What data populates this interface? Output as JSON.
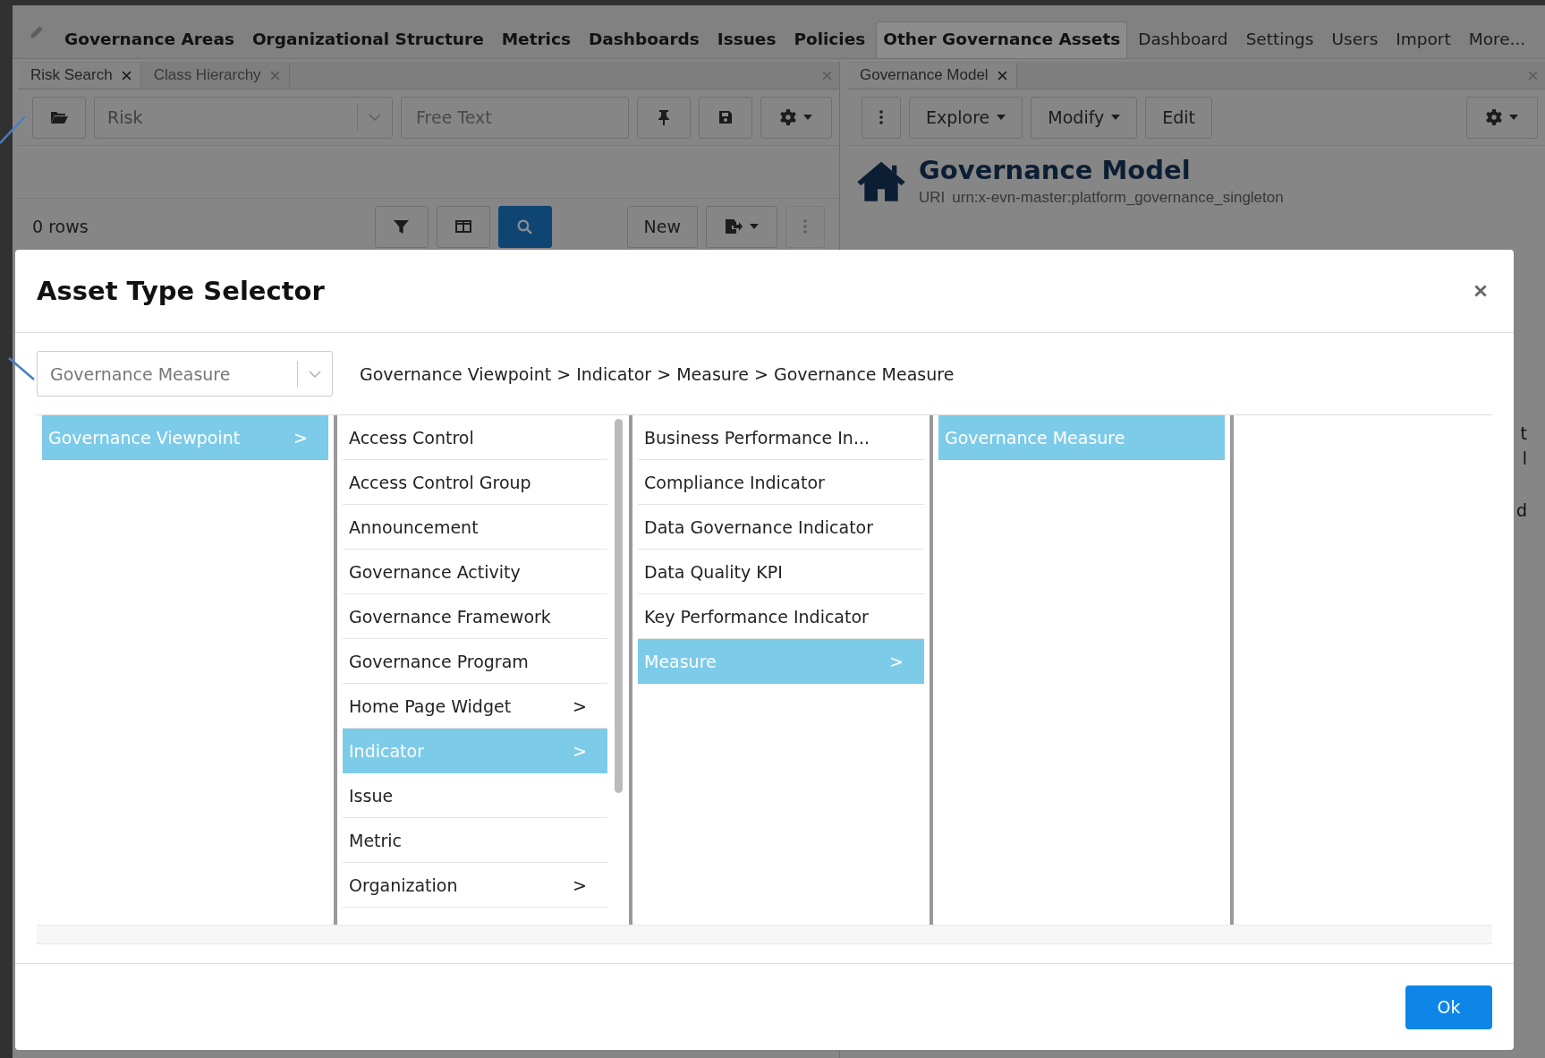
{
  "nav": {
    "items": [
      {
        "label": "Governance Areas",
        "bold": true,
        "selected": false
      },
      {
        "label": "Organizational Structure",
        "bold": true,
        "selected": false
      },
      {
        "label": "Metrics",
        "bold": true,
        "selected": false
      },
      {
        "label": "Dashboards",
        "bold": true,
        "selected": false
      },
      {
        "label": "Issues",
        "bold": true,
        "selected": false
      },
      {
        "label": "Policies",
        "bold": true,
        "selected": false
      },
      {
        "label": "Other Governance Assets",
        "bold": true,
        "selected": true
      },
      {
        "label": "Dashboard",
        "bold": false,
        "selected": false
      },
      {
        "label": "Settings",
        "bold": false,
        "selected": false
      },
      {
        "label": "Users",
        "bold": false,
        "selected": false
      },
      {
        "label": "Import",
        "bold": false,
        "selected": false
      },
      {
        "label": "More...",
        "bold": false,
        "selected": false
      }
    ]
  },
  "left_panel": {
    "tabs": [
      {
        "label": "Risk Search",
        "selected": true
      },
      {
        "label": "Class Hierarchy",
        "selected": false
      }
    ],
    "type_select": {
      "value": "Risk"
    },
    "search": {
      "placeholder": "Free Text"
    },
    "row_count": "0 rows",
    "new_button": "New"
  },
  "right_panel": {
    "tabs": [
      {
        "label": "Governance Model",
        "selected": true
      }
    ],
    "buttons": [
      "Explore",
      "Modify",
      "Edit"
    ],
    "title": "Governance Model",
    "uri_label": "URI",
    "uri": "urn:x-evn-master:platform_governance_singleton",
    "fragments": [
      "t",
      "l",
      "d"
    ]
  },
  "dialog": {
    "title": "Asset Type Selector",
    "type_select": {
      "value": "Governance Measure"
    },
    "breadcrumb": "Governance Viewpoint > Indicator > Measure > Governance Measure",
    "columns": [
      {
        "items": [
          {
            "label": "Governance Viewpoint",
            "selected": true,
            "arrow": ">"
          }
        ]
      },
      {
        "items": [
          {
            "label": "Access Control",
            "selected": false
          },
          {
            "label": "Access Control Group",
            "selected": false
          },
          {
            "label": "Announcement",
            "selected": false
          },
          {
            "label": "Governance Activity",
            "selected": false
          },
          {
            "label": "Governance Framework",
            "selected": false
          },
          {
            "label": "Governance Program",
            "selected": false
          },
          {
            "label": "Home Page Widget",
            "selected": false,
            "arrow": ">"
          },
          {
            "label": "Indicator",
            "selected": true,
            "arrow": ">"
          },
          {
            "label": "Issue",
            "selected": false
          },
          {
            "label": "Metric",
            "selected": false
          },
          {
            "label": "Organization",
            "selected": false,
            "arrow": ">"
          }
        ]
      },
      {
        "items": [
          {
            "label": "Business Performance In...",
            "selected": false
          },
          {
            "label": "Compliance Indicator",
            "selected": false
          },
          {
            "label": "Data Governance Indicator",
            "selected": false
          },
          {
            "label": "Data Quality KPI",
            "selected": false
          },
          {
            "label": "Key Performance Indicator",
            "selected": false
          },
          {
            "label": "Measure",
            "selected": true,
            "arrow": ">"
          }
        ]
      },
      {
        "items": [
          {
            "label": "Governance Measure",
            "selected": true
          }
        ]
      },
      {}
    ],
    "ok_button": "Ok"
  }
}
